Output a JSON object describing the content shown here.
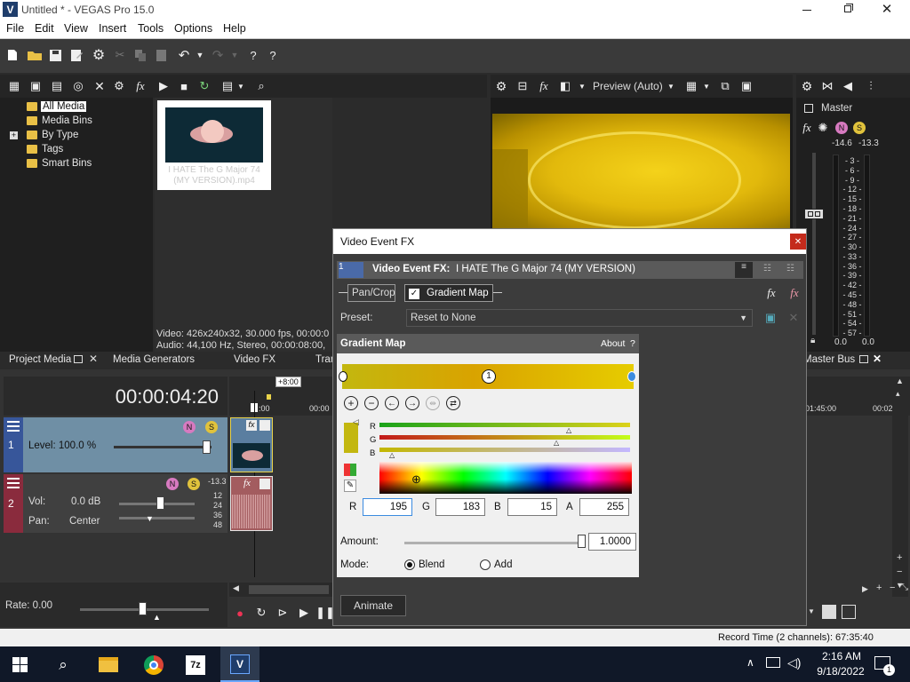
{
  "window": {
    "title": "Untitled * - VEGAS Pro 15.0",
    "app_icon": "V"
  },
  "menu": [
    "File",
    "Edit",
    "View",
    "Insert",
    "Tools",
    "Options",
    "Help"
  ],
  "media_tree": [
    "All Media",
    "Media Bins",
    "By Type",
    "Tags",
    "Smart Bins"
  ],
  "media_thumb": {
    "caption_line1": "I HATE The G Major 74",
    "caption_line2": "(MY VERSION).mp4"
  },
  "media_info": {
    "video": "Video: 426x240x32, 30.000 fps, 00:00:0",
    "audio": "Audio: 44,100 Hz, Stereo, 00:00:08:00,"
  },
  "panel_tabs": [
    "Project Media",
    "Media Generators",
    "Video FX",
    "Tran"
  ],
  "preview": {
    "label": "Preview (Auto)"
  },
  "master": {
    "label": "Master",
    "peak_left": "-14.6",
    "peak_right": "-13.3",
    "scale": [
      "3",
      "6",
      "9",
      "12",
      "15",
      "18",
      "21",
      "24",
      "27",
      "30",
      "33",
      "36",
      "39",
      "42",
      "45",
      "48",
      "51",
      "54",
      "57"
    ],
    "bottom_left": "0.0",
    "bottom_right": "0.0",
    "bus_tab": "Master Bus"
  },
  "timeline": {
    "timecode": "00:00:04:20",
    "offset_badge": "+8:00",
    "ruler_left": ":00",
    "ruler_mid": "00:00",
    "ruler_right1": "01:45:00",
    "ruler_right2": "00:02",
    "video_track": {
      "number": "1",
      "level": "Level: 100.0 %"
    },
    "audio_track": {
      "number": "2",
      "vol_label": "Vol:",
      "vol_value": "0.0 dB",
      "pan_label": "Pan:",
      "pan_value": "Center",
      "meter_top": "-13.3",
      "meter_marks": [
        "12",
        "24",
        "36",
        "48"
      ]
    },
    "rate": "Rate: 0.00"
  },
  "status": {
    "record_time": "Record Time (2 channels): 67:35:40"
  },
  "dialog": {
    "title": "Video Event FX",
    "header_label": "Video Event FX:",
    "header_value": "I HATE The G Major 74 (MY VERSION)",
    "chain": [
      "Pan/Crop",
      "Gradient Map"
    ],
    "preset_label": "Preset:",
    "preset_value": "Reset to None",
    "plugin_title": "Gradient Map",
    "about": "About",
    "help": "?",
    "marker": "1",
    "channels": [
      "R",
      "G",
      "B"
    ],
    "rgba": {
      "r_label": "R",
      "r": "195",
      "g_label": "G",
      "g": "183",
      "b_label": "B",
      "b": "15",
      "a_label": "A",
      "a": "255"
    },
    "amount_label": "Amount:",
    "amount": "1.0000",
    "amount_fraction": 1.0,
    "mode_label": "Mode:",
    "modes": [
      "Blend",
      "Add"
    ],
    "selected_mode": "Blend",
    "animate": "Animate",
    "gradient_colors": [
      "#c3b70f",
      "#d9a300",
      "#e6cc00"
    ]
  },
  "taskbar": {
    "time": "2:16 AM",
    "date": "9/18/2022",
    "notification_count": "1",
    "seven_zip": "7z",
    "vegas": "V"
  }
}
